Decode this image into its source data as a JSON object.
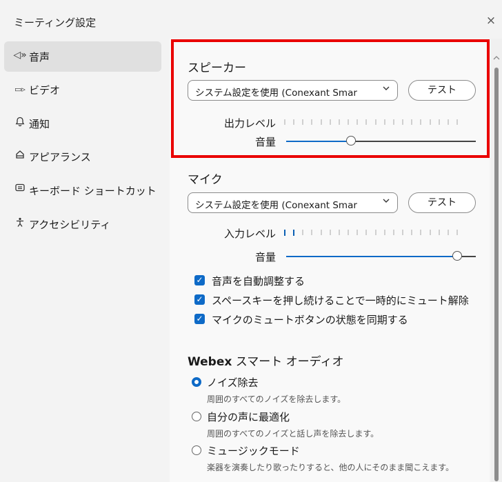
{
  "window": {
    "title": "ミーティング設定",
    "close_icon": "×"
  },
  "sidebar": {
    "items": [
      {
        "icon": "speaker-icon",
        "glyph": "◁»",
        "label": "音声",
        "active": true
      },
      {
        "icon": "video-icon",
        "glyph": "▭▹",
        "label": "ビデオ",
        "active": false
      },
      {
        "icon": "bell-icon",
        "glyph": "🔔",
        "label": "通知",
        "active": false
      },
      {
        "icon": "appearance-icon",
        "glyph": "⌂",
        "label": "アピアランス",
        "active": false
      },
      {
        "icon": "keyboard-icon",
        "glyph": "⌨",
        "label": "キーボード ショートカット",
        "active": false
      },
      {
        "icon": "accessibility-icon",
        "glyph": "♿",
        "label": "アクセシビリティ",
        "active": false
      }
    ]
  },
  "speaker": {
    "title": "スピーカー",
    "device": "システム設定を使用 (Conexant Smar",
    "test_label": "テスト",
    "output_level_label": "出力レベル",
    "output_level": 0,
    "volume_label": "音量",
    "volume": 0.34
  },
  "mic": {
    "title": "マイク",
    "device": "システム設定を使用 (Conexant Smar",
    "test_label": "テスト",
    "input_level_label": "入力レベル",
    "input_level": 2,
    "volume_label": "音量",
    "volume": 0.9
  },
  "options": [
    {
      "label": "音声を自動調整する",
      "checked": true
    },
    {
      "label": "スペースキーを押し続けることで一時的にミュート解除",
      "checked": true
    },
    {
      "label": "マイクのミュートボタンの状態を同期する",
      "checked": true
    }
  ],
  "smart_audio": {
    "title_bold": "Webex",
    "title_rest": " スマート オーディオ",
    "options": [
      {
        "label": "ノイズ除去",
        "desc": "周囲のすべてのノイズを除去します。",
        "selected": true
      },
      {
        "label": "自分の声に最適化",
        "desc": "周囲のすべてのノイズと話し声を除去します。",
        "selected": false
      },
      {
        "label": "ミュージックモード",
        "desc": "楽器を演奏したり歌ったりすると、他の人にそのまま聞こえます。",
        "selected": false
      }
    ]
  },
  "colors": {
    "accent": "#0e6ac7",
    "highlight": "#ea0000"
  }
}
